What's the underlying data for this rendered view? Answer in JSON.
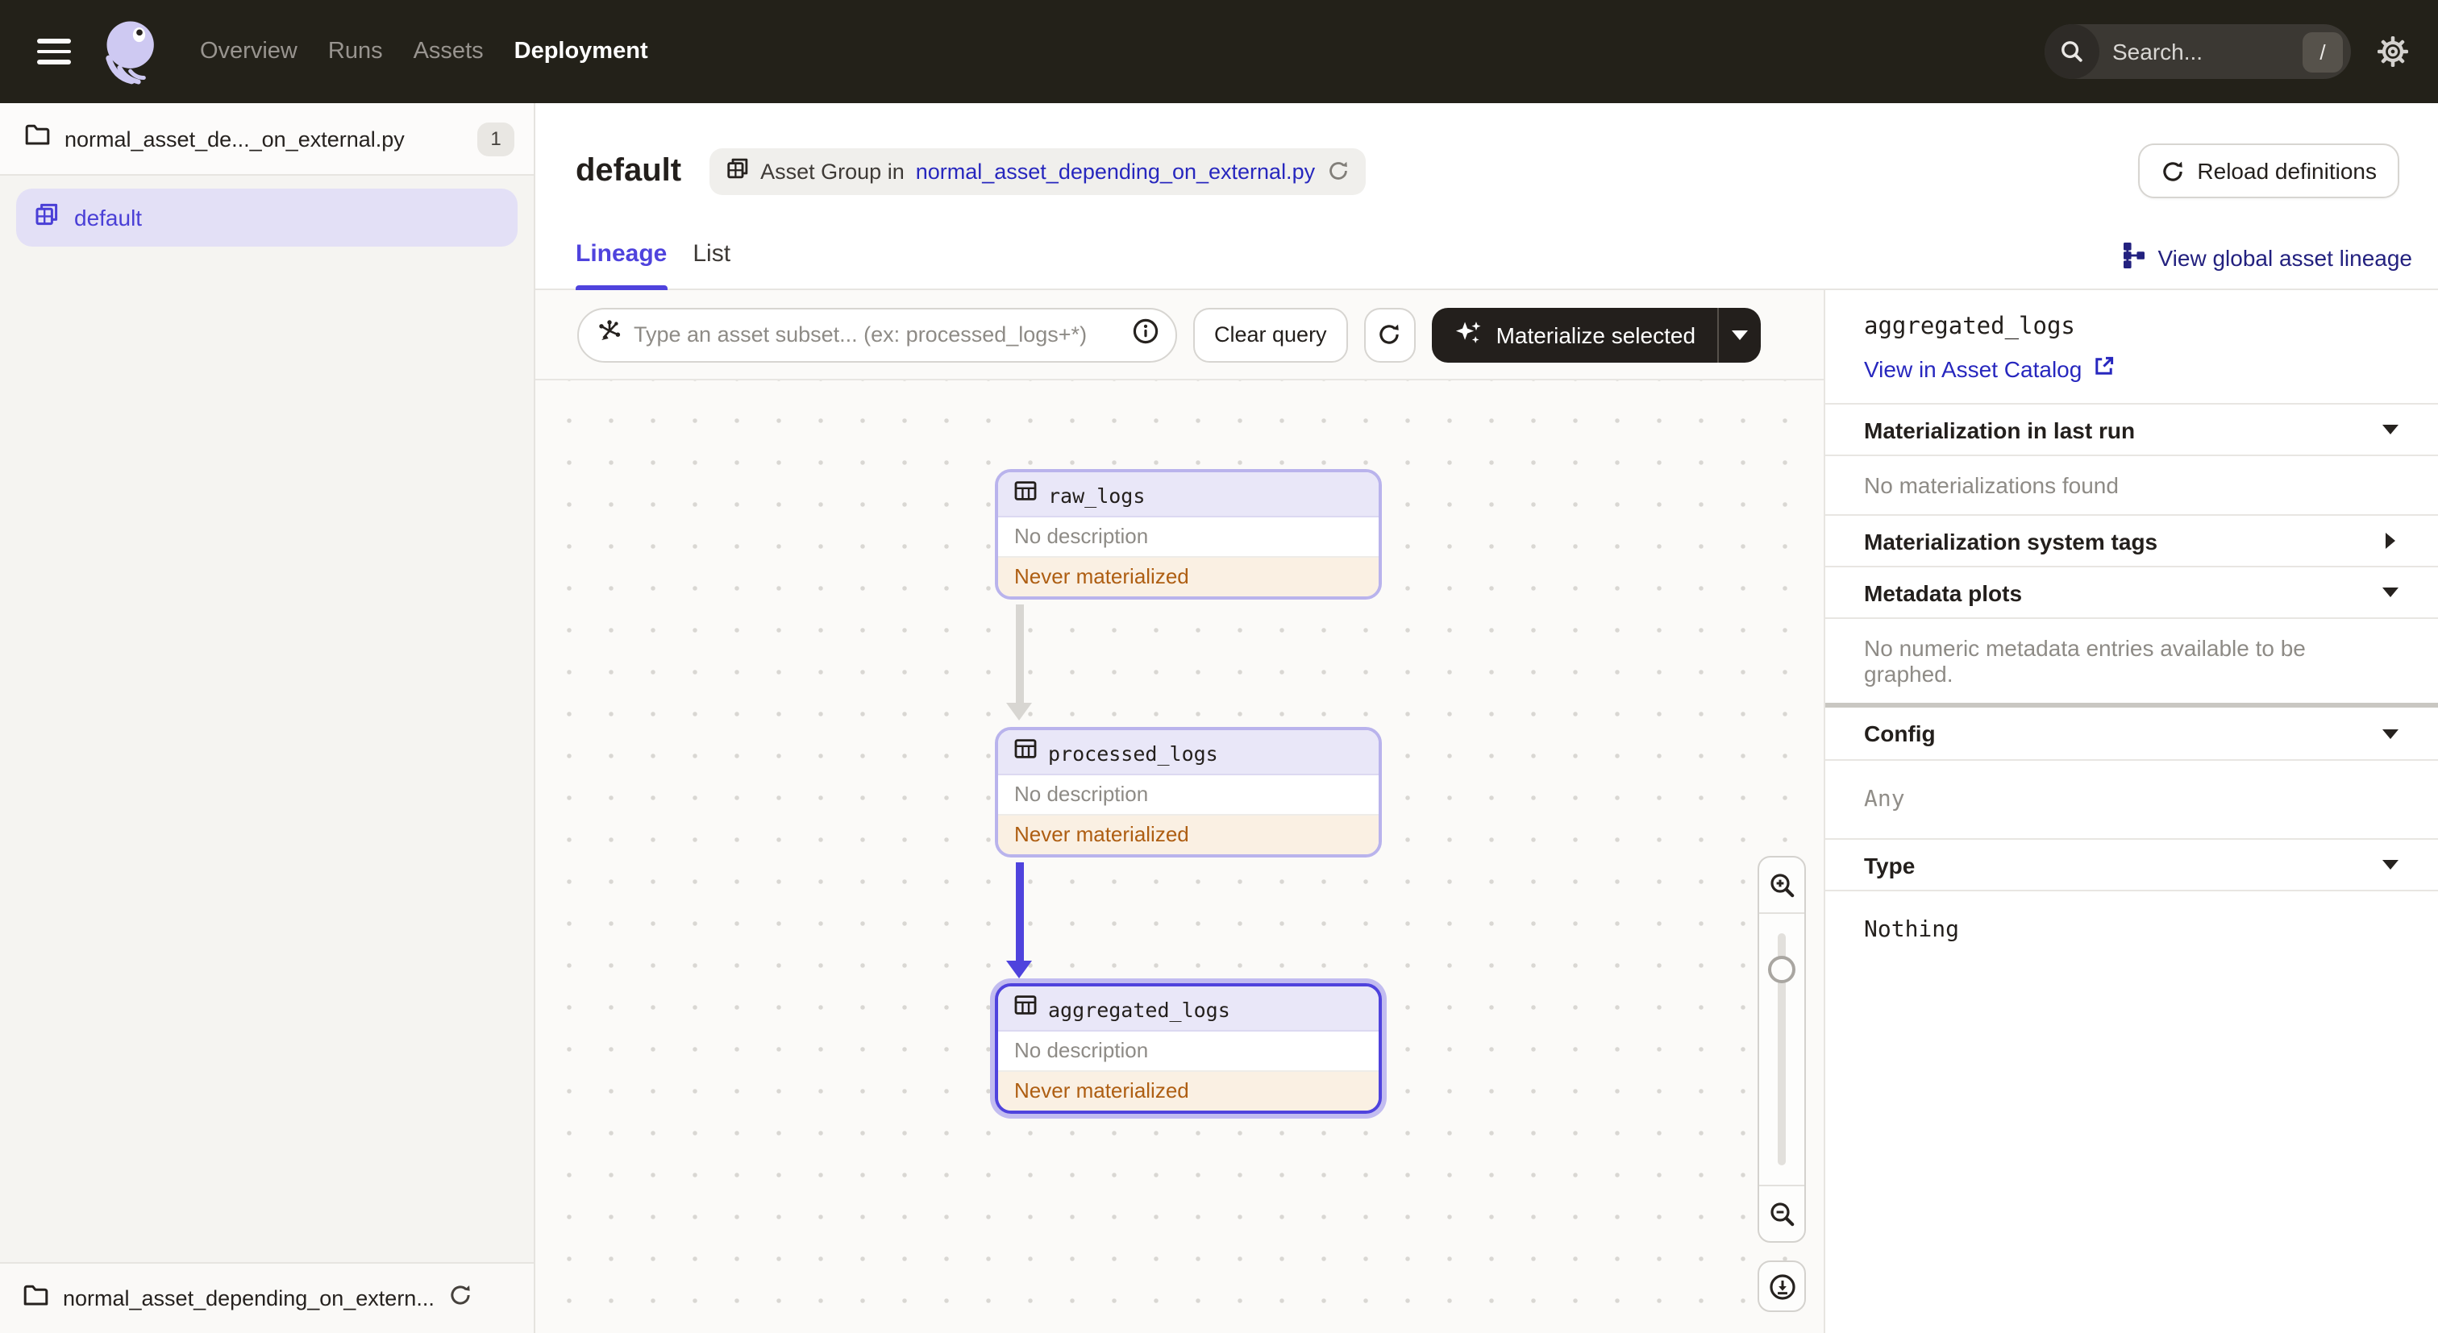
{
  "topnav": {
    "nav": [
      {
        "label": "Overview",
        "active": false
      },
      {
        "label": "Runs",
        "active": false
      },
      {
        "label": "Assets",
        "active": false
      },
      {
        "label": "Deployment",
        "active": true
      }
    ],
    "search": {
      "placeholder": "Search...",
      "shortcut": "/"
    }
  },
  "sidebar": {
    "top_item": {
      "label": "normal_asset_de..._on_external.py",
      "badge": "1"
    },
    "selected_group": {
      "label": "default"
    },
    "bottom_item": {
      "label": "normal_asset_depending_on_extern..."
    }
  },
  "header": {
    "title": "default",
    "breadcrumb": {
      "prefix": "Asset Group in",
      "link": "normal_asset_depending_on_external.py"
    },
    "reload_button": "Reload definitions"
  },
  "tabs": [
    {
      "label": "Lineage",
      "active": true
    },
    {
      "label": "List",
      "active": false
    }
  ],
  "global_lineage_link": "View global asset lineage",
  "toolbar": {
    "query_placeholder": "Type an asset subset... (ex: processed_logs+*)",
    "clear_button": "Clear query",
    "materialize_button": "Materialize selected"
  },
  "graph": {
    "nodes": [
      {
        "name": "raw_logs",
        "description": "No description",
        "status": "Never materialized",
        "selected": false
      },
      {
        "name": "processed_logs",
        "description": "No description",
        "status": "Never materialized",
        "selected": false
      },
      {
        "name": "aggregated_logs",
        "description": "No description",
        "status": "Never materialized",
        "selected": true
      }
    ]
  },
  "details_panel": {
    "title": "aggregated_logs",
    "catalog_link": "View in Asset Catalog",
    "sections": [
      {
        "label": "Materialization in last run",
        "state": "expanded",
        "content": "No materializations found"
      },
      {
        "label": "Materialization system tags",
        "state": "collapsed",
        "content": ""
      },
      {
        "label": "Metadata plots",
        "state": "expanded",
        "content": "No numeric metadata entries available to be graphed."
      },
      {
        "label": "Config",
        "state": "expanded",
        "content": "Any"
      },
      {
        "label": "Type",
        "state": "expanded",
        "content": "Nothing"
      }
    ]
  },
  "colors": {
    "accent": "#4F43DD",
    "link_blue": "#2727BE",
    "link_navy": "#23217F",
    "status_warning_text": "#AE5E12",
    "status_warning_bg": "#FAF0E3",
    "topnav_bg": "#232119",
    "selected_row_bg": "#E3E0F6"
  }
}
